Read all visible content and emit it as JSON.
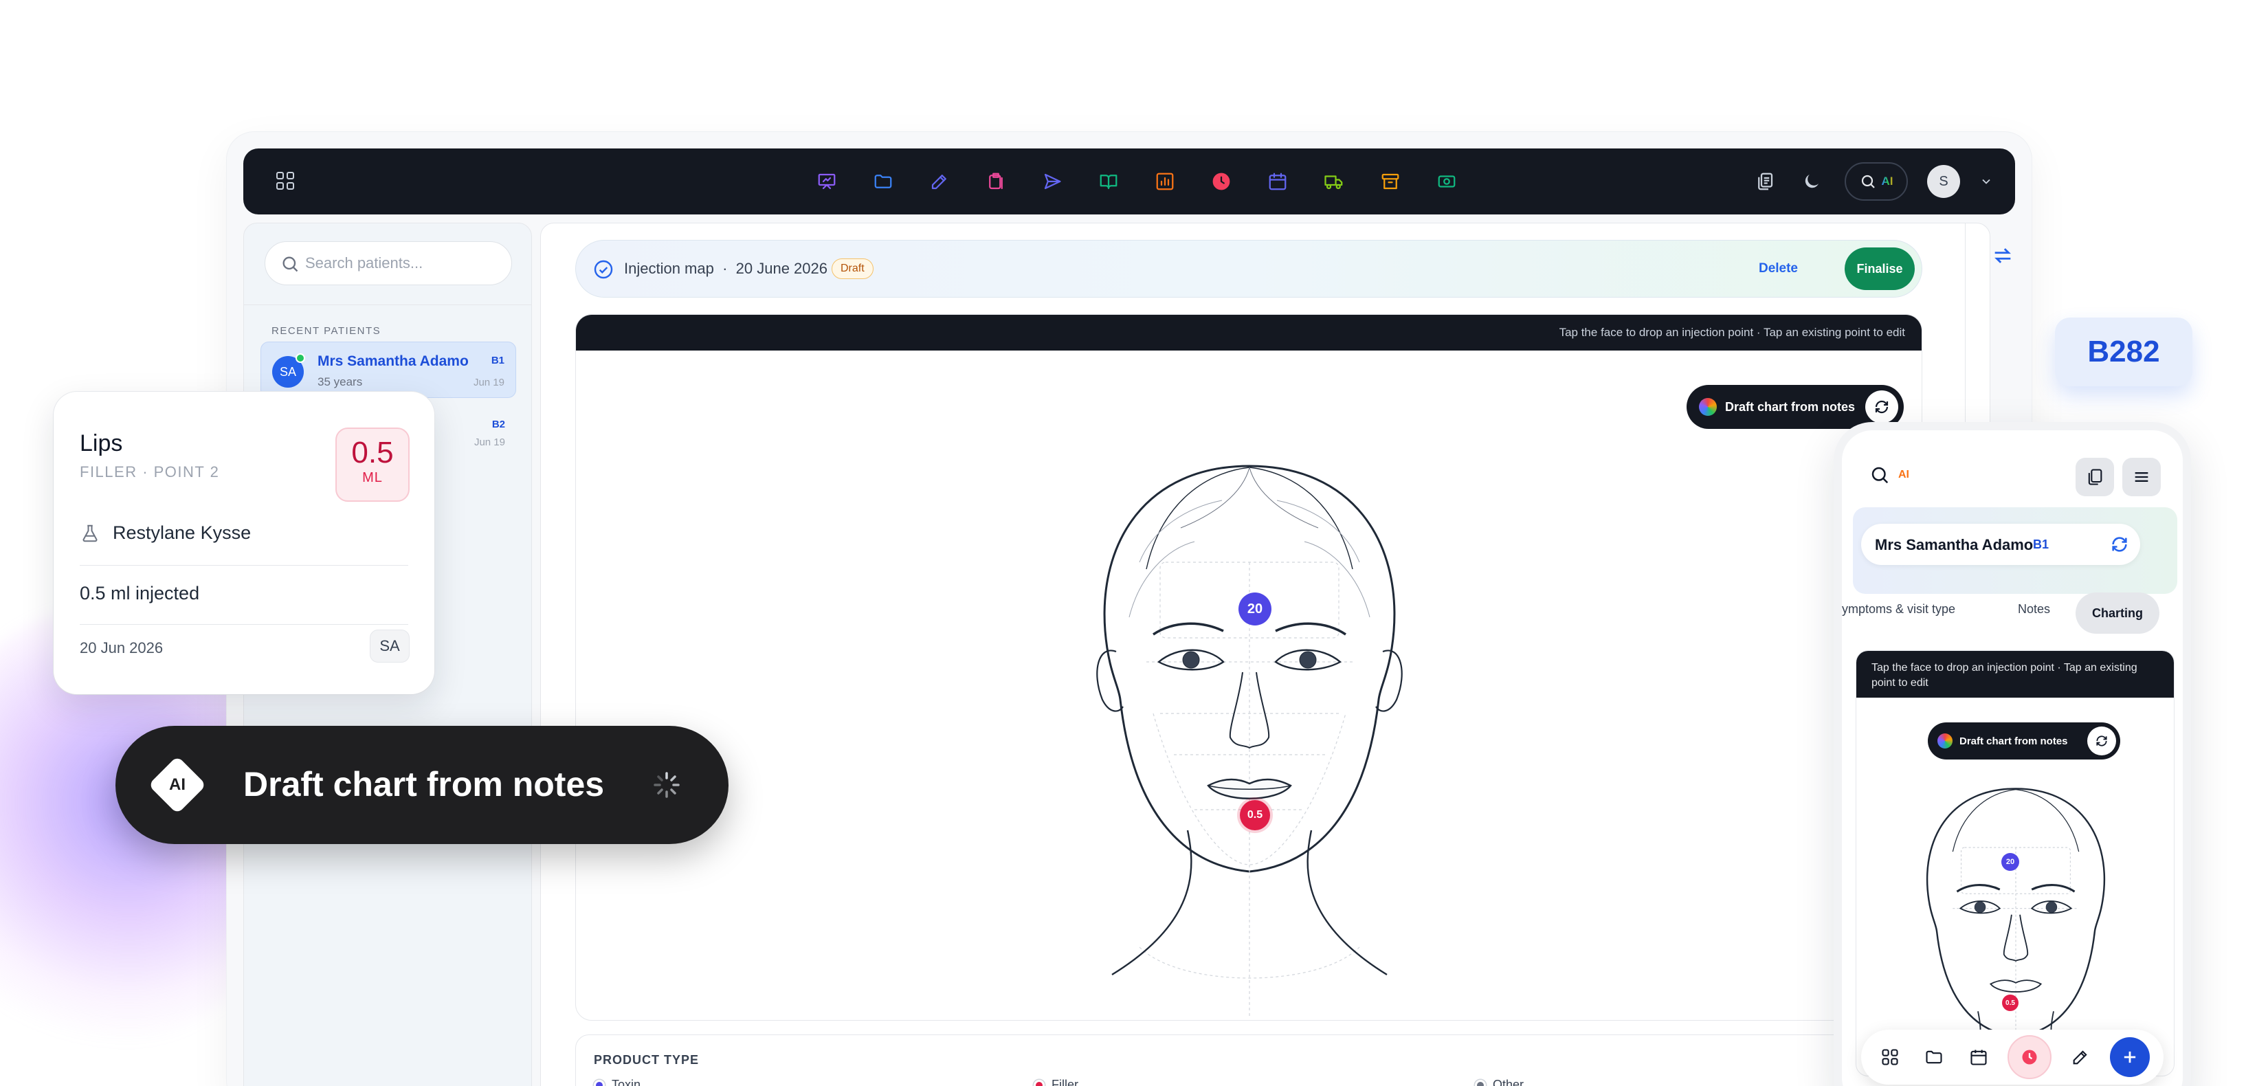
{
  "topbar": {
    "nav_icons": [
      "presentation-icon",
      "folder-icon",
      "edit-icon",
      "clipboard-icon",
      "send-icon",
      "book-icon",
      "chart-icon",
      "clock-icon",
      "calendar-icon",
      "truck-icon",
      "archive-icon",
      "money-icon"
    ],
    "nav_colors": [
      "#8b5cf6",
      "#3b82f6",
      "#6366f1",
      "#ec4899",
      "#6366f1",
      "#10b981",
      "#f97316",
      "#f43f5e",
      "#6366f1",
      "#84cc16",
      "#f59e0b",
      "#10b981"
    ],
    "ai_label": "AI",
    "avatar_initial": "S"
  },
  "sidebar": {
    "search_placeholder": "Search patients...",
    "recent_label": "RECENT PATIENTS",
    "patients": [
      {
        "initials": "SA",
        "name": "Mrs Samantha Adamo",
        "sub": "35 years",
        "code": "B1",
        "date": "Jun 19"
      },
      {
        "initials": "",
        "name": "",
        "sub": "",
        "code": "B2",
        "date": "Jun 19"
      }
    ]
  },
  "status_bar": {
    "title": "Injection map",
    "separator": "·",
    "date": "20 June 2026",
    "badge": "Draft",
    "delete_label": "Delete",
    "finalise_label": "Finalise"
  },
  "canvas": {
    "instruction": "Tap the face to drop an injection point · Tap an existing point to edit",
    "draft_pill": "Draft chart from notes",
    "points": [
      {
        "label": "20",
        "color": "#4f46e5"
      },
      {
        "label": "0.5",
        "color": "#e11d48"
      }
    ]
  },
  "product": {
    "label": "PRODUCT TYPE",
    "legend": [
      {
        "label": "Toxin",
        "color": "#4f46e5"
      },
      {
        "label": "Filler",
        "color": "#e11d48"
      },
      {
        "label": "Other",
        "color": "#6b7280"
      }
    ]
  },
  "lips_card": {
    "title": "Lips",
    "subtitle": "FILLER · POINT 2",
    "volume": "0.5",
    "unit": "ML",
    "product": "Restylane Kysse",
    "injected": "0.5 ml injected",
    "date": "20 Jun 2026",
    "initials": "SA"
  },
  "draft_big": {
    "ai_label": "AI",
    "text": "Draft chart from notes"
  },
  "badge": "B282",
  "phone": {
    "search_ai": "AI",
    "patient_name": "Mrs Samantha Adamo",
    "patient_code": "B1",
    "tabs": [
      "ymptoms & visit type",
      "Notes",
      "Charting"
    ],
    "instruction": "Tap the face to drop an injection point · Tap an existing point to edit",
    "draft_pill": "Draft chart from notes",
    "points": [
      "20",
      "0.5"
    ]
  }
}
